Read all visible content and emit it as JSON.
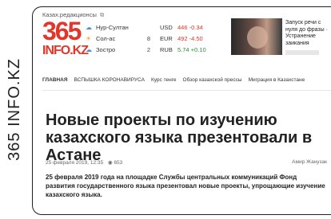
{
  "watermark": "365 INFO.KZ",
  "site": {
    "edition": "Казах.редакционсы",
    "logo_number": "365",
    "logo_text": "INFO.KZ"
  },
  "widgets": [
    {
      "icon": "☁",
      "city": "Нур-Султан",
      "temp": "",
      "currency": "USD",
      "rate": "446 -0.34",
      "up": false
    },
    {
      "icon": "☀",
      "city": "Сол-ас",
      "temp": "8",
      "currency": "EUR",
      "rate": "492 -4.50",
      "up": false
    },
    {
      "icon": "☁",
      "city": "Зострo",
      "temp": "2",
      "currency": "RUB",
      "rate": "5.74 +0.10",
      "up": true
    }
  ],
  "teaser": {
    "title": "Запуск речи с нуля до фразы · Устранение заикания"
  },
  "nav": [
    "ГЛАВНАЯ",
    "ВСПЫШКА КОРОНАВИРУСА",
    "Курс тенге",
    "Обзор казахской прессы",
    "Миграция в Казахстане"
  ],
  "article": {
    "headline": "Новые проекты по изучению казахского языка презентовали в Астане",
    "date": "25 февраля 2019, 12:35",
    "views": "653",
    "author": "Амир Жанузак",
    "lead": "25 февраля 2019 года на площадке Службы центральных коммуникаций Фонд развития государственного языка презентовал новые проекты, упрощающие изучение казахского языка."
  }
}
